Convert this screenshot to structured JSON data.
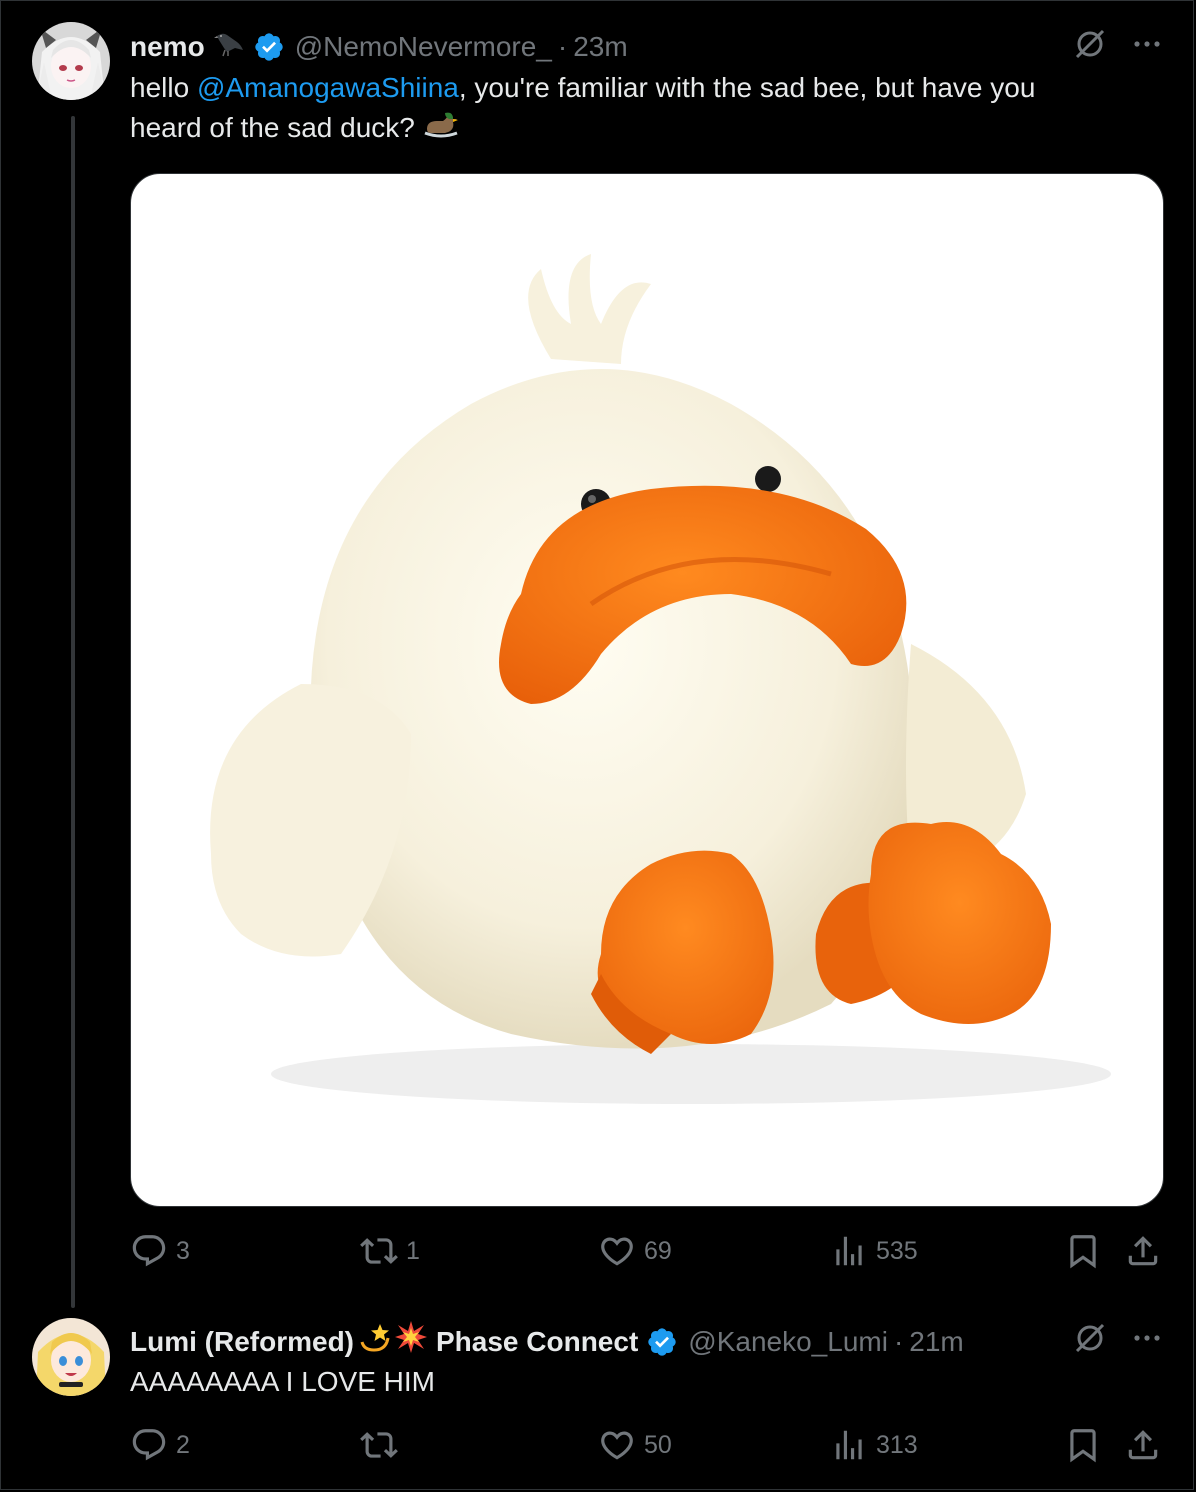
{
  "tweet": {
    "author_name": "nemo",
    "handle": "@NemoNevermore_",
    "time": "23m",
    "text_before": "hello ",
    "mention": "@AmanogawaShiina",
    "text_line1_after": ", you're familiar with the sad bee, but have you",
    "text_line2": "heard of the sad duck?",
    "stats": {
      "replies": "3",
      "reposts": "1",
      "likes": "69",
      "views": "535"
    }
  },
  "reply": {
    "author_name": "Lumi (Reformed)",
    "author_suffix": "Phase Connect",
    "handle": "@Kaneko_Lumi",
    "time": "21m",
    "text": "AAAAAAAA I LOVE HIM",
    "stats": {
      "replies": "2",
      "reposts": "",
      "likes": "50",
      "views": "313"
    }
  },
  "separator": "·",
  "colors": {
    "background": "#000000",
    "text": "#e7e9ea",
    "muted": "#71767b",
    "accent": "#1d9bf0",
    "verified_badge": "#1d9bf0"
  },
  "icons": [
    "crow-icon",
    "verified-badge-icon",
    "grok-icon",
    "more-icon",
    "reply-icon",
    "repost-icon",
    "like-icon",
    "views-icon",
    "bookmark-icon",
    "share-icon",
    "dizzy-icon",
    "collision-icon",
    "duck-icon"
  ]
}
